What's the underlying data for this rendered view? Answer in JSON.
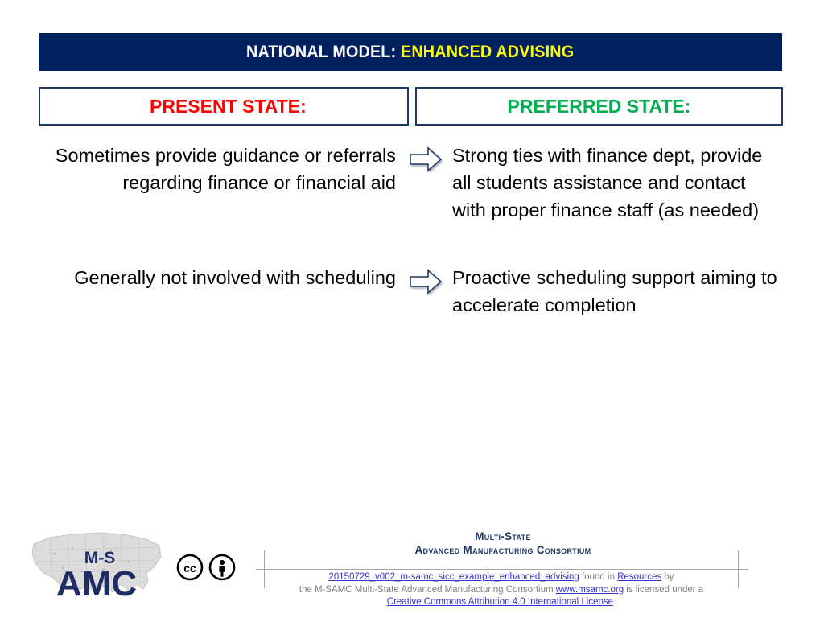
{
  "slide": {
    "title": {
      "prefix": "NATIONAL MODEL:",
      "highlight": "ENHANCED ADVISING",
      "bg_color": "#002060",
      "prefix_color": "#FFFFFF",
      "highlight_color": "#FFFF00"
    },
    "columns": {
      "left_heading": "PRESENT STATE:",
      "left_heading_color": "#FF0000",
      "right_heading": "PREFERRED STATE:",
      "right_heading_color": "#00B050",
      "box_border_color": "#1F3864"
    },
    "rows": [
      {
        "left": "Sometimes provide guidance or referrals regarding finance or financial aid",
        "arrow": "right-arrow-icon",
        "right": "Strong ties with finance dept, provide all students assistance and contact with proper finance staff (as needed)"
      },
      {
        "left": "Generally not involved with scheduling",
        "arrow": "right-arrow-icon",
        "right": "Proactive scheduling support aiming to accelerate completion"
      }
    ]
  },
  "footer": {
    "logo": {
      "top_text": "M-S",
      "main_text": "AMC",
      "color": "#1F2D64"
    },
    "cc_badges": [
      "cc-icon",
      "by-person-icon"
    ],
    "consortium_line1": "Multi-State",
    "consortium_line2": "Advanced  Manufacturing  Consortium",
    "consortium_color": "#1F3864",
    "license": {
      "doc_link": "20150729_v002_m-samc_sicc_example_enhanced_advising",
      "found_in": " found in ",
      "resources_link": "Resources",
      "by": " by",
      "org_text": "the M-SAMC Multi-State Advanced Manufacturing Consortium ",
      "site_link": "www.msamc.org",
      "licensed_under": " is licensed under a",
      "license_link": "Creative Commons Attribution 4.0 International License",
      "period": ".",
      "link_color": "#3333CC",
      "text_color": "#808080"
    }
  }
}
